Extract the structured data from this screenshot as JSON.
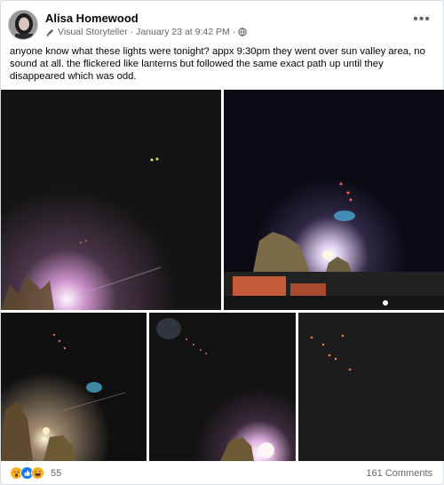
{
  "post": {
    "author_name": "Alisa Homewood",
    "author_badge": "Visual Storyteller",
    "timestamp": "January 23 at 9:42 PM",
    "caption": "anyone know what these lights were tonight? appx 9:30pm they went over sun valley area, no sound at all.  the flickered like lanterns but followed the same exact path up until they disappeared which was odd.",
    "photos": [
      {
        "description_icon": "photo"
      },
      {
        "description_icon": "photo"
      },
      {
        "description_icon": "photo"
      },
      {
        "description_icon": "photo"
      },
      {
        "description_icon": "photo"
      }
    ]
  },
  "engagement": {
    "reactions": [
      "wow",
      "like",
      "haha"
    ],
    "reaction_count": "55",
    "comments_label": "161 Comments"
  },
  "colors": {
    "text_primary": "#050505",
    "text_secondary": "#65676b",
    "like_blue": "#1877f2",
    "reaction_yellow": "#f7b125"
  }
}
